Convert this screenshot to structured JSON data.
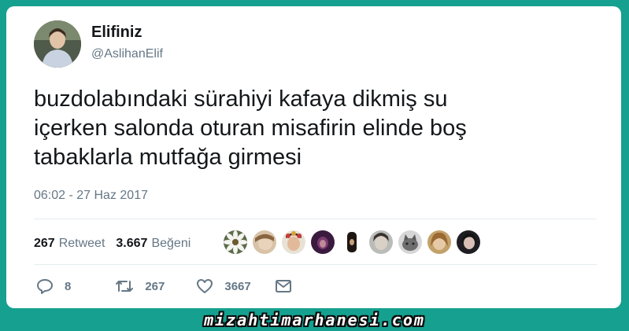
{
  "tweet": {
    "display_name": "Elifiniz",
    "handle": "@AslihanElif",
    "text": "buzdolabındaki sürahiyi kafaya dikmiş su\niçerken salonda oturan misafirin elinde boş\ntabaklarla mutfağa girmesi",
    "timestamp": "06:02 - 27 Haz 2017"
  },
  "stats": {
    "retweets": "267",
    "retweets_label": "Retweet",
    "likes": "3.667",
    "likes_label": "Beğeni"
  },
  "actions": {
    "reply_icon": "reply-icon",
    "reply_count": "8",
    "retweet_icon": "retweet-icon",
    "retweet_count": "267",
    "like_icon": "heart-icon",
    "like_count": "3667",
    "message_icon": "envelope-icon"
  },
  "footer": {
    "watermark": "mizahtimarhanesi.com"
  },
  "colors": {
    "background": "#15a08f",
    "card": "#ffffff",
    "text": "#14171a",
    "secondary": "#657786"
  }
}
